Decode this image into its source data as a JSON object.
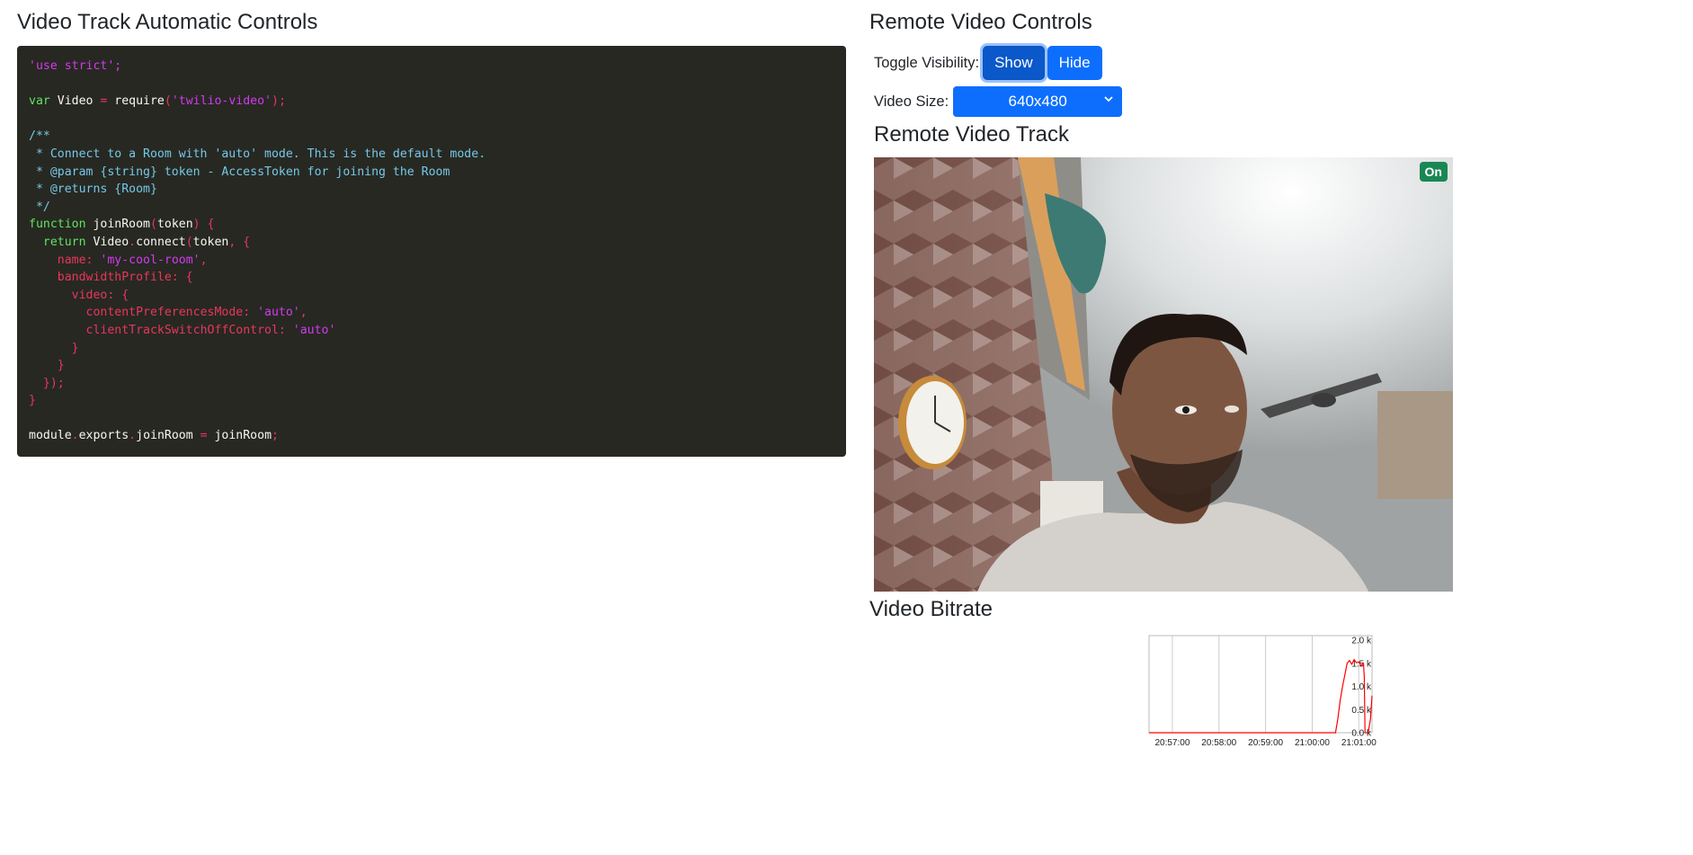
{
  "left_panel": {
    "title": "Video Track Automatic Controls",
    "code_lines": [
      "'use strict';",
      "",
      "var Video = require('twilio-video');",
      "",
      "/**",
      " * Connect to a Room with 'auto' mode. This is the default mode.",
      " * @param {string} token - AccessToken for joining the Room",
      " * @returns {Room}",
      " */",
      "function joinRoom(token) {",
      "  return Video.connect(token, {",
      "    name: 'my-cool-room',",
      "    bandwidthProfile: {",
      "      video: {",
      "        contentPreferencesMode: 'auto',",
      "        clientTrackSwitchOffControl: 'auto'",
      "      }",
      "    }",
      "  });",
      "}",
      "",
      "module.exports.joinRoom = joinRoom;"
    ]
  },
  "right_panel": {
    "controls_title": "Remote Video Controls",
    "toggle_label": "Toggle Visibility:",
    "show_label": "Show",
    "hide_label": "Hide",
    "size_label": "Video Size:",
    "size_value": "640x480",
    "track_title": "Remote Video Track",
    "status_badge": "On",
    "status_color": "#198754",
    "bitrate_title": "Video Bitrate"
  },
  "colors": {
    "primary": "#0d6efd",
    "primary_active": "#0a58ca",
    "code_bg": "#272822",
    "line": "#ff0000"
  },
  "chart_data": {
    "type": "line",
    "title": "",
    "xlabel": "",
    "ylabel": "",
    "x_ticks": [
      "20:57:00",
      "20:58:00",
      "20:59:00",
      "21:00:00",
      "21:01:00"
    ],
    "y_ticks": [
      "2.0 k",
      "1.5 k",
      "1.0 k",
      "0.5 k",
      "0.0 k"
    ],
    "ylim": [
      0,
      2000
    ],
    "grid": true,
    "series": [
      {
        "x": [
          "20:56:30",
          "20:57:00",
          "20:58:00",
          "20:59:00",
          "21:00:00",
          "21:00:30",
          "21:00:33",
          "21:00:36",
          "21:00:39",
          "21:00:42",
          "21:00:45",
          "21:00:48",
          "21:00:51",
          "21:00:54",
          "21:00:57",
          "21:01:00",
          "21:01:03",
          "21:01:06",
          "21:01:07",
          "21:01:08",
          "21:01:09",
          "21:01:12",
          "21:01:15",
          "21:01:17"
        ],
        "y": [
          0,
          0,
          0,
          0,
          0,
          0,
          300,
          700,
          1000,
          1250,
          1500,
          1560,
          1480,
          1580,
          1510,
          1530,
          1450,
          1500,
          1200,
          0,
          0,
          0,
          300,
          800
        ]
      }
    ]
  }
}
